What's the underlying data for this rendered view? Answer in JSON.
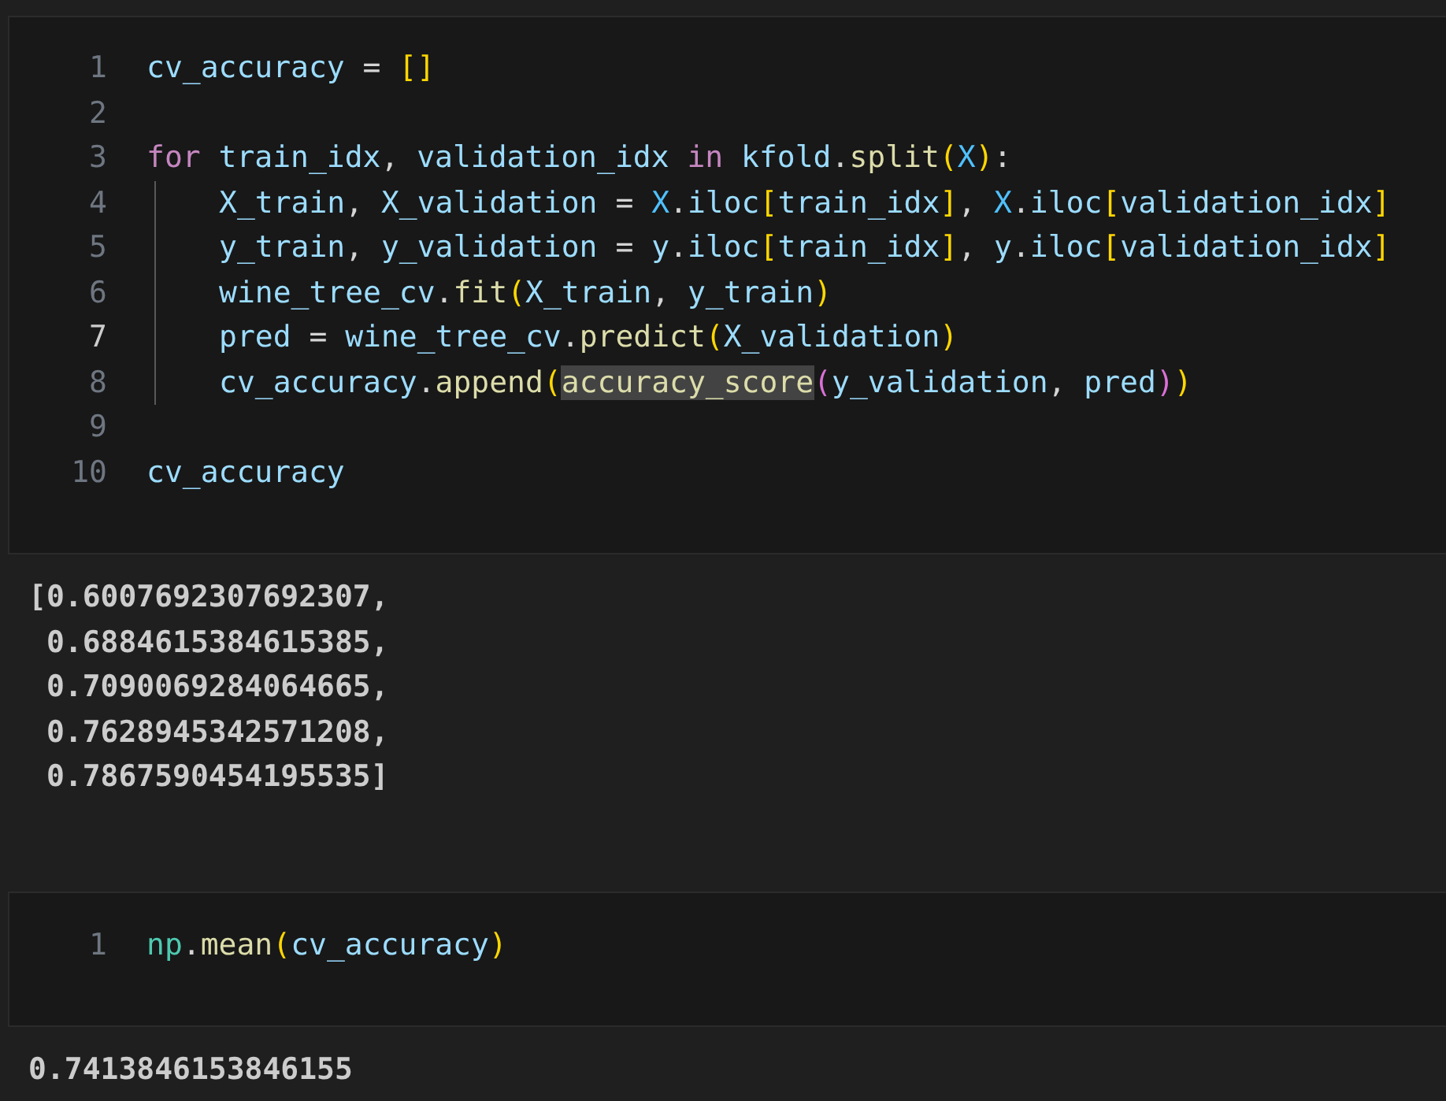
{
  "cells": [
    {
      "lines": [
        {
          "number": "1",
          "active": false,
          "tokens": [
            {
              "kind": "var",
              "text": "cv_accuracy"
            },
            {
              "kind": "plain",
              "text": " = "
            },
            {
              "kind": "bracket1",
              "text": "[]"
            }
          ]
        },
        {
          "number": "2",
          "active": false
        },
        {
          "number": "3",
          "active": false,
          "tokens": [
            {
              "kind": "keyword",
              "text": "for "
            },
            {
              "kind": "var",
              "text": "train_idx"
            },
            {
              "kind": "plain",
              "text": ", "
            },
            {
              "kind": "var",
              "text": "validation_idx "
            },
            {
              "kind": "keyword",
              "text": "in "
            },
            {
              "kind": "var",
              "text": "kfold"
            },
            {
              "kind": "plain",
              "text": "."
            },
            {
              "kind": "function",
              "text": "split"
            },
            {
              "kind": "bracket1",
              "text": "("
            },
            {
              "kind": "constant",
              "text": "X"
            },
            {
              "kind": "bracket1",
              "text": ")"
            },
            {
              "kind": "plain",
              "text": ":"
            }
          ],
          "children": [
            {
              "number": "4",
              "active": false,
              "tokens": [
                {
                  "kind": "var",
                  "text": "X_train"
                },
                {
                  "kind": "plain",
                  "text": ", "
                },
                {
                  "kind": "var",
                  "text": "X_validation"
                },
                {
                  "kind": "plain",
                  "text": " = "
                },
                {
                  "kind": "constant",
                  "text": "X"
                },
                {
                  "kind": "plain",
                  "text": "."
                },
                {
                  "kind": "var",
                  "text": "iloc"
                },
                {
                  "kind": "bracket1",
                  "text": "["
                },
                {
                  "kind": "var",
                  "text": "train_idx"
                },
                {
                  "kind": "bracket1",
                  "text": "]"
                },
                {
                  "kind": "plain",
                  "text": ", "
                },
                {
                  "kind": "constant",
                  "text": "X"
                },
                {
                  "kind": "plain",
                  "text": "."
                },
                {
                  "kind": "var",
                  "text": "iloc"
                },
                {
                  "kind": "bracket1",
                  "text": "["
                },
                {
                  "kind": "var",
                  "text": "validation_idx"
                },
                {
                  "kind": "bracket1",
                  "text": "]"
                }
              ]
            },
            {
              "number": "5",
              "active": false,
              "tokens": [
                {
                  "kind": "var",
                  "text": "y_train"
                },
                {
                  "kind": "plain",
                  "text": ", "
                },
                {
                  "kind": "var",
                  "text": "y_validation"
                },
                {
                  "kind": "plain",
                  "text": " = "
                },
                {
                  "kind": "var",
                  "text": "y"
                },
                {
                  "kind": "plain",
                  "text": "."
                },
                {
                  "kind": "var",
                  "text": "iloc"
                },
                {
                  "kind": "bracket1",
                  "text": "["
                },
                {
                  "kind": "var",
                  "text": "train_idx"
                },
                {
                  "kind": "bracket1",
                  "text": "]"
                },
                {
                  "kind": "plain",
                  "text": ", "
                },
                {
                  "kind": "var",
                  "text": "y"
                },
                {
                  "kind": "plain",
                  "text": "."
                },
                {
                  "kind": "var",
                  "text": "iloc"
                },
                {
                  "kind": "bracket1",
                  "text": "["
                },
                {
                  "kind": "var",
                  "text": "validation_idx"
                },
                {
                  "kind": "bracket1",
                  "text": "]"
                }
              ]
            },
            {
              "number": "6",
              "active": false,
              "tokens": [
                {
                  "kind": "var",
                  "text": "wine_tree_cv"
                },
                {
                  "kind": "plain",
                  "text": "."
                },
                {
                  "kind": "function",
                  "text": "fit"
                },
                {
                  "kind": "bracket1",
                  "text": "("
                },
                {
                  "kind": "var",
                  "text": "X_train"
                },
                {
                  "kind": "plain",
                  "text": ", "
                },
                {
                  "kind": "var",
                  "text": "y_train"
                },
                {
                  "kind": "bracket1",
                  "text": ")"
                }
              ]
            },
            {
              "number": "7",
              "active": true,
              "tokens": [
                {
                  "kind": "var",
                  "text": "pred"
                },
                {
                  "kind": "plain",
                  "text": " = "
                },
                {
                  "kind": "var",
                  "text": "wine_tree_cv"
                },
                {
                  "kind": "plain",
                  "text": "."
                },
                {
                  "kind": "function",
                  "text": "predict"
                },
                {
                  "kind": "bracket1",
                  "text": "("
                },
                {
                  "kind": "var",
                  "text": "X_validation"
                },
                {
                  "kind": "bracket1",
                  "text": ")"
                }
              ]
            },
            {
              "number": "8",
              "active": false,
              "tokens": [
                {
                  "kind": "var",
                  "text": "cv_accuracy"
                },
                {
                  "kind": "plain",
                  "text": "."
                },
                {
                  "kind": "function",
                  "text": "append"
                },
                {
                  "kind": "bracket1",
                  "text": "("
                },
                {
                  "kind": "match",
                  "text": "accuracy_score"
                },
                {
                  "kind": "bracket2",
                  "text": "("
                },
                {
                  "kind": "var",
                  "text": "y_validation"
                },
                {
                  "kind": "plain",
                  "text": ", "
                },
                {
                  "kind": "var",
                  "text": "pred"
                },
                {
                  "kind": "bracket2",
                  "text": ")"
                },
                {
                  "kind": "bracket1",
                  "text": ")"
                }
              ]
            }
          ]
        },
        {
          "number": "9",
          "active": false
        },
        {
          "number": "10",
          "active": false,
          "tokens": [
            {
              "kind": "var",
              "text": "cv_accuracy"
            }
          ]
        }
      ],
      "output": [
        "[0.6007692307692307,",
        " 0.6884615384615385,",
        " 0.7090069284064665,",
        " 0.7628945342571208,",
        " 0.7867590454195535]"
      ]
    },
    {
      "lines": [
        {
          "number": "1",
          "active": false,
          "tokens": [
            {
              "kind": "module",
              "text": "np"
            },
            {
              "kind": "plain",
              "text": "."
            },
            {
              "kind": "function",
              "text": "mean"
            },
            {
              "kind": "bracket1",
              "text": "("
            },
            {
              "kind": "var",
              "text": "cv_accuracy"
            },
            {
              "kind": "bracket1",
              "text": ")"
            }
          ]
        }
      ],
      "output": [
        "0.7413846153846155"
      ]
    }
  ]
}
